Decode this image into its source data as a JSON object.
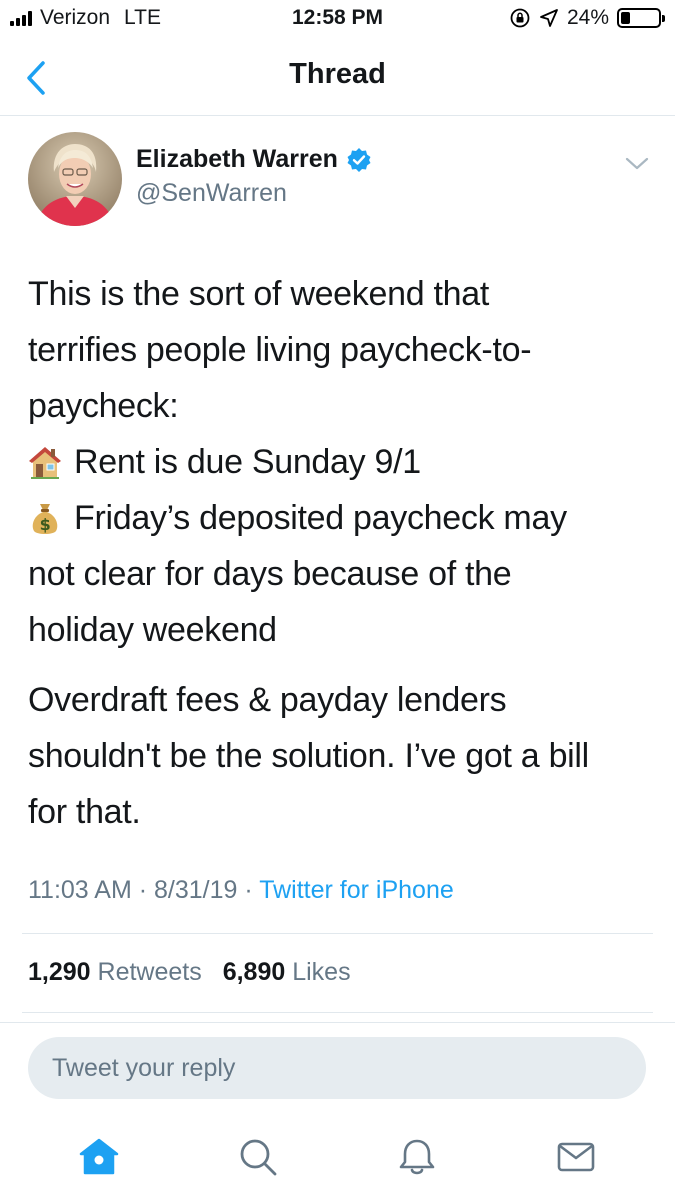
{
  "status_bar": {
    "carrier": "Verizon",
    "network": "LTE",
    "time": "12:58 PM",
    "battery": "24%",
    "battery_level": 0.24
  },
  "nav": {
    "title": "Thread",
    "back_icon": "chevron-left-icon"
  },
  "tweet": {
    "author_name": "Elizabeth Warren",
    "verified": true,
    "handle": "@SenWarren",
    "paragraph1": [
      "This is the sort of weekend that",
      "terrifies people living paycheck-to-",
      "paycheck:"
    ],
    "bullet1_emoji": "house-emoji",
    "bullet1_text": "Rent is due Sunday 9/1",
    "bullet2_emoji": "money-bag-emoji",
    "bullet2_text": "Friday’s deposited paycheck may",
    "bullet2_continued": [
      "not clear for days because of the",
      "holiday weekend"
    ],
    "paragraph2": [
      "Overdraft fees & payday lenders",
      "shouldn't be the solution. I’ve got a bill",
      "for that."
    ],
    "time": "11:03 AM",
    "date": "8/31/19",
    "separator": "·",
    "source": "Twitter for iPhone"
  },
  "stats": {
    "retweets_count": "1,290",
    "retweets_label": "Retweets",
    "likes_count": "6,890",
    "likes_label": "Likes"
  },
  "reply": {
    "placeholder": "Tweet your reply"
  },
  "tab_bar": {
    "items": [
      "home-icon",
      "search-icon",
      "notifications-icon",
      "messages-icon"
    ],
    "active": "home-icon"
  },
  "colors": {
    "accent": "#1da1f2",
    "text": "#14171a",
    "secondary": "#657786",
    "divider": "#e1e8ed",
    "reply_bg": "#e6ecf0"
  }
}
